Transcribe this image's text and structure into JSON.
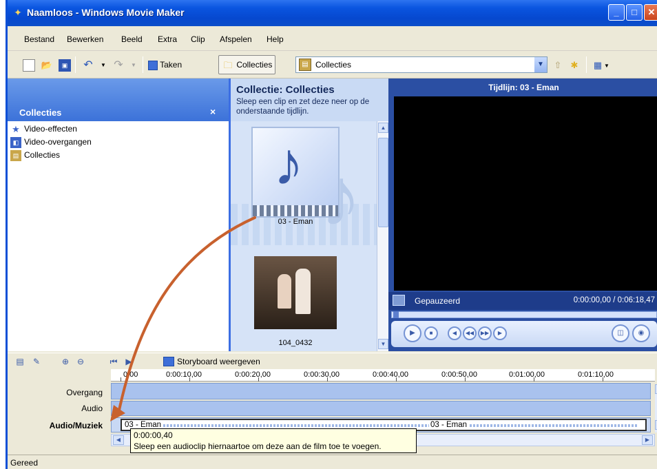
{
  "window": {
    "title": "Naamloos - Windows Movie Maker"
  },
  "menu": {
    "items": [
      "Bestand",
      "Bewerken",
      "Beeld",
      "Extra",
      "Clip",
      "Afspelen",
      "Help"
    ]
  },
  "toolbar": {
    "tasks_label": "Taken",
    "collections_label": "Collecties",
    "collections_combo_value": "Collecties"
  },
  "left_panel": {
    "title": "Collecties",
    "items": [
      {
        "label": "Video-effecten",
        "icon": "star-icon"
      },
      {
        "label": "Video-overgangen",
        "icon": "transition-icon"
      },
      {
        "label": "Collecties",
        "icon": "collection-icon"
      }
    ]
  },
  "collection_panel": {
    "title": "Collectie: Collecties",
    "description": "Sleep een clip en zet deze neer op de onderstaande tijdlijn.",
    "clips": [
      {
        "label": "03 - Eman"
      },
      {
        "label": "104_0432"
      }
    ]
  },
  "preview": {
    "title": "Tijdlijn: 03 - Eman",
    "status": "Gepauzeerd",
    "time": "0:00:00,00 / 0:06:18,47"
  },
  "timeline": {
    "storyboard_label": "Storyboard weergeven",
    "ruler": [
      "0,00",
      "0:00:10,00",
      "0:00:20,00",
      "0:00:30,00",
      "0:00:40,00",
      "0:00:50,00",
      "0:01:00,00",
      "0:01:10,00"
    ],
    "tracks": {
      "transition": "Overgang",
      "audio": "Audio",
      "audio_music": "Audio/Muziek"
    },
    "audio_clip_label": "03 - Eman",
    "tooltip_time": "0:00:00,40",
    "tooltip_text": "Sleep een audioclip hiernaartoe om deze aan de film toe te voegen."
  },
  "statusbar": {
    "text": "Gereed"
  },
  "colors": {
    "accent": "#3c6ee3",
    "arrow": "#c8612e",
    "titlebar": "#0a55e0"
  }
}
